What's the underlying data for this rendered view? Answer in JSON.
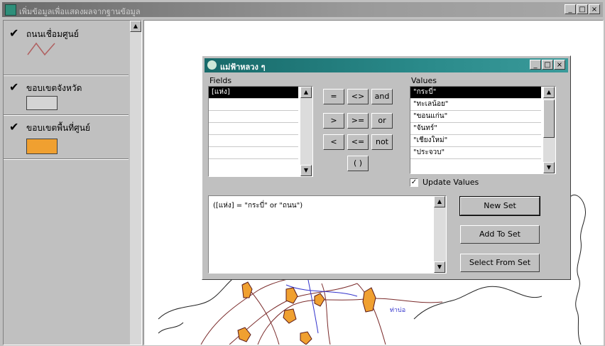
{
  "main_window": {
    "title": "เพิ่มข้อมูลเพื่อแสดงผลจากฐานข้อมูล",
    "caption_buttons": [
      "_",
      "□",
      "×"
    ]
  },
  "legend": {
    "items": [
      {
        "label": "ถนนเชื่อมศูนย์",
        "symbol": "line"
      },
      {
        "label": "ขอบเขตจังหวัด",
        "symbol": "box-gray"
      },
      {
        "label": "ขอบเขตพื้นที่ศูนย์",
        "symbol": "box-orange"
      }
    ]
  },
  "map": {
    "label": "ท่าบ่อ"
  },
  "dialog": {
    "title": "แม่ฟ้าหลวง ๆ",
    "caption_buttons": [
      "_",
      "□",
      "×"
    ],
    "fields_label": "Fields",
    "fields": [
      "[แห่ง]",
      "",
      "",
      "",
      "",
      ""
    ],
    "values_label": "Values",
    "values": [
      "\"กระบี่\"",
      "\"ทะเลน้อย\"",
      "\"ขอนแก่น\"",
      "\"จันทร์\"",
      "\"เชียงใหม่\"",
      "\"ประจวบ\""
    ],
    "operators": [
      "=",
      "<>",
      "and",
      ">",
      ">=",
      "or",
      "<",
      "<=",
      "not",
      "( )"
    ],
    "update_values_label": "Update Values",
    "update_values_checked": "✓",
    "expression": "([แห่ง] = \"กระบี่\" or \"ถนน\")",
    "buttons": {
      "new_set": "New Set",
      "add_to_set": "Add To Set",
      "select_from_set": "Select From Set"
    }
  },
  "colors": {
    "title_teal": "#186a6a",
    "polygon_orange": "#f0a030",
    "road_brown": "#7a2a2a",
    "road_blue": "#3333cc"
  }
}
